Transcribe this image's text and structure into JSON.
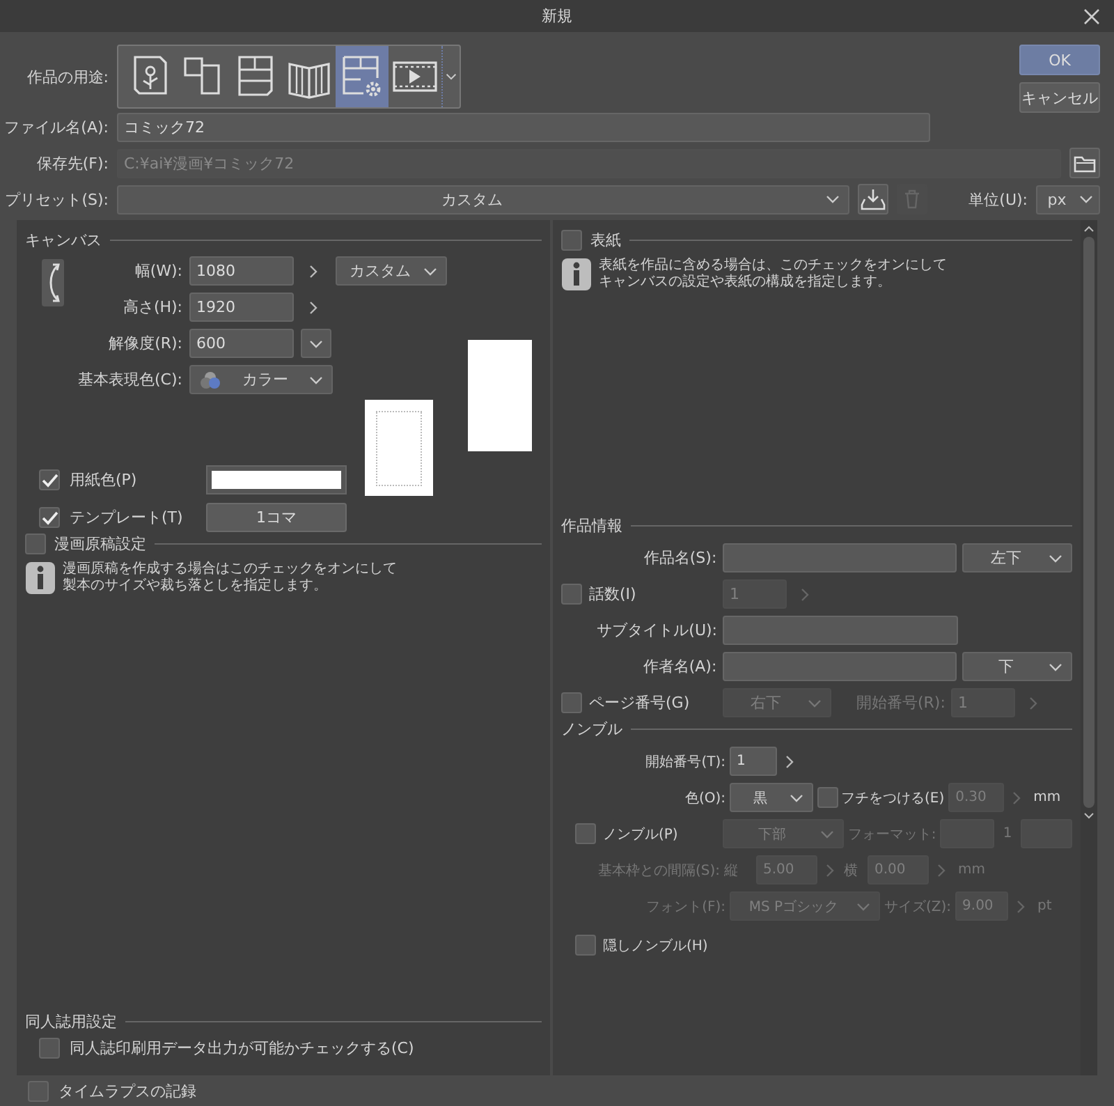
{
  "window": {
    "title": "新規"
  },
  "usage": {
    "label": "作品の用途:",
    "options": [
      {
        "kind": "illustration",
        "selected": false
      },
      {
        "kind": "webtoon",
        "selected": false
      },
      {
        "kind": "comic",
        "selected": false
      },
      {
        "kind": "book",
        "selected": false
      },
      {
        "kind": "custom",
        "selected": true
      },
      {
        "kind": "animation",
        "selected": false
      }
    ]
  },
  "buttons": {
    "ok": "OK",
    "cancel": "キャンセル"
  },
  "file_name": {
    "label": "ファイル名(A):",
    "value": "コミック72"
  },
  "save_location": {
    "label": "保存先(F):",
    "value": "C:¥ai¥漫画¥コミック72"
  },
  "preset": {
    "label": "プリセット(S):",
    "value": "カスタム"
  },
  "unit": {
    "label": "単位(U):",
    "value": "px"
  },
  "canvas": {
    "title": "キャンバス",
    "width": {
      "label": "幅(W):",
      "value": "1080"
    },
    "size_preset": "カスタム",
    "height": {
      "label": "高さ(H):",
      "value": "1920"
    },
    "resolution": {
      "label": "解像度(R):",
      "value": "600"
    },
    "color_mode": {
      "label": "基本表現色(C):",
      "value": "カラー"
    },
    "paper_color": {
      "label": "用紙色(P)",
      "checked": true
    },
    "template": {
      "label": "テンプレート(T)",
      "checked": true,
      "value": "1コマ"
    }
  },
  "manga": {
    "label": "漫画原稿設定",
    "checked": false,
    "info": [
      "漫画原稿を作成する場合はこのチェックをオンにして",
      "製本のサイズや裁ち落としを指定します。"
    ]
  },
  "doujin": {
    "title": "同人誌用設定",
    "check": {
      "label": "同人誌印刷用データ出力が可能かチェックする(C)",
      "checked": false
    }
  },
  "cover": {
    "label": "表紙",
    "checked": false,
    "info": [
      "表紙を作品に含める場合は、このチェックをオンにして",
      "キャンバスの設定や表紙の構成を指定します。"
    ]
  },
  "work_info": {
    "title": "作品情報",
    "title_field": {
      "label": "作品名(S):",
      "position": "左下"
    },
    "episode": {
      "label": "話数(I)",
      "checked": false,
      "value": "1"
    },
    "subtitle": {
      "label": "サブタイトル(U):"
    },
    "author": {
      "label": "作者名(A):",
      "position": "下"
    },
    "page_number": {
      "label": "ページ番号(G)",
      "checked": false,
      "position": "右下",
      "start_label": "開始番号(R):",
      "start": "1"
    }
  },
  "nombre": {
    "title": "ノンブル",
    "start": {
      "label": "開始番号(T):",
      "value": "1"
    },
    "color": {
      "label": "色(O):",
      "value": "黒"
    },
    "border": {
      "label": "フチをつける(E)",
      "checked": false,
      "value": "0.30",
      "unit": "mm"
    },
    "enabled": {
      "label": "ノンブル(P)",
      "checked": false,
      "position": "下部",
      "format_label": "フォーマット:",
      "format": "1"
    },
    "margin": {
      "label": "基本枠との間隔(S):",
      "vertical_label": "縦",
      "vertical": "5.00",
      "horizontal_label": "横",
      "horizontal": "0.00",
      "unit": "mm"
    },
    "font": {
      "label": "フォント(F):",
      "value": "MS Pゴシック",
      "size_label": "サイズ(Z):",
      "size": "9.00",
      "unit": "pt"
    },
    "hidden": {
      "label": "隠しノンブル(H)",
      "checked": false
    }
  },
  "timelapse": {
    "label": "タイムラプスの記録",
    "checked": false
  }
}
